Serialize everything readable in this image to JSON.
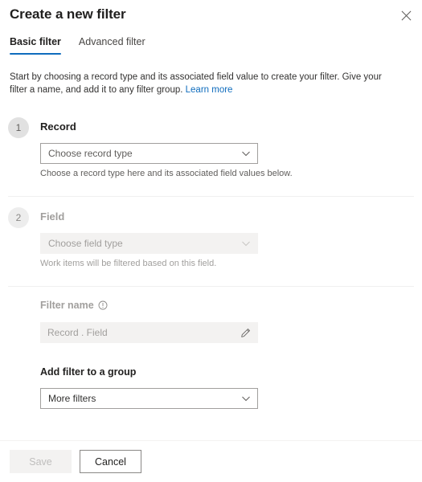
{
  "panel": {
    "title": "Create a new filter",
    "close_icon": "close-icon"
  },
  "tabs": [
    {
      "label": "Basic filter",
      "active": true
    },
    {
      "label": "Advanced filter",
      "active": false
    }
  ],
  "description": {
    "text": "Start by choosing a record type and its associated field value to create your filter. Give your filter a name, and add it to any filter group.",
    "link_label": "Learn more"
  },
  "steps": [
    {
      "number": "1",
      "label": "Record",
      "dropdown_value": "Choose record type",
      "hint": "Choose a record type here and its associated field values below.",
      "disabled": false
    },
    {
      "number": "2",
      "label": "Field",
      "dropdown_value": "Choose field type",
      "hint": "Work items will be filtered based on this field.",
      "disabled": true
    }
  ],
  "filter_name": {
    "label": "Filter name",
    "info_icon": "info-circle-icon",
    "value": "",
    "placeholder": "Record . Field",
    "edit_icon": "pencil-icon"
  },
  "group": {
    "label": "Add filter to a group",
    "dropdown_value": "More filters"
  },
  "footer": {
    "save_label": "Save",
    "cancel_label": "Cancel"
  },
  "colors": {
    "accent": "#0f6cbd",
    "link": "#0f6cbd",
    "text_primary": "#201f1e",
    "text_secondary": "#605e5c",
    "text_disabled": "#a19f9d",
    "border": "#a19f9d",
    "disabled_fill": "#f3f2f1",
    "badge_fill": "#e1e1e1",
    "divider": "#f0f0f0"
  }
}
